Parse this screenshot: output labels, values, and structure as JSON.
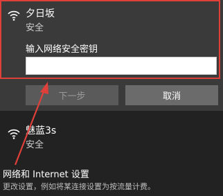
{
  "networks": [
    {
      "name": "夕日坂",
      "status": "安全"
    },
    {
      "name": "魅蓝3s",
      "status": "安全"
    }
  ],
  "connect_form": {
    "key_label": "输入网络安全密钥",
    "key_value": "",
    "next_label": "下一步",
    "cancel_label": "取消"
  },
  "settings": {
    "link_label": "网络和 Internet 设置",
    "description": "更改设置，例如将某连接设置为按流量计费。"
  },
  "colors": {
    "highlight": "#e0403a",
    "arrow": "#e0403a"
  },
  "icons": {
    "wifi": "wifi-icon"
  }
}
